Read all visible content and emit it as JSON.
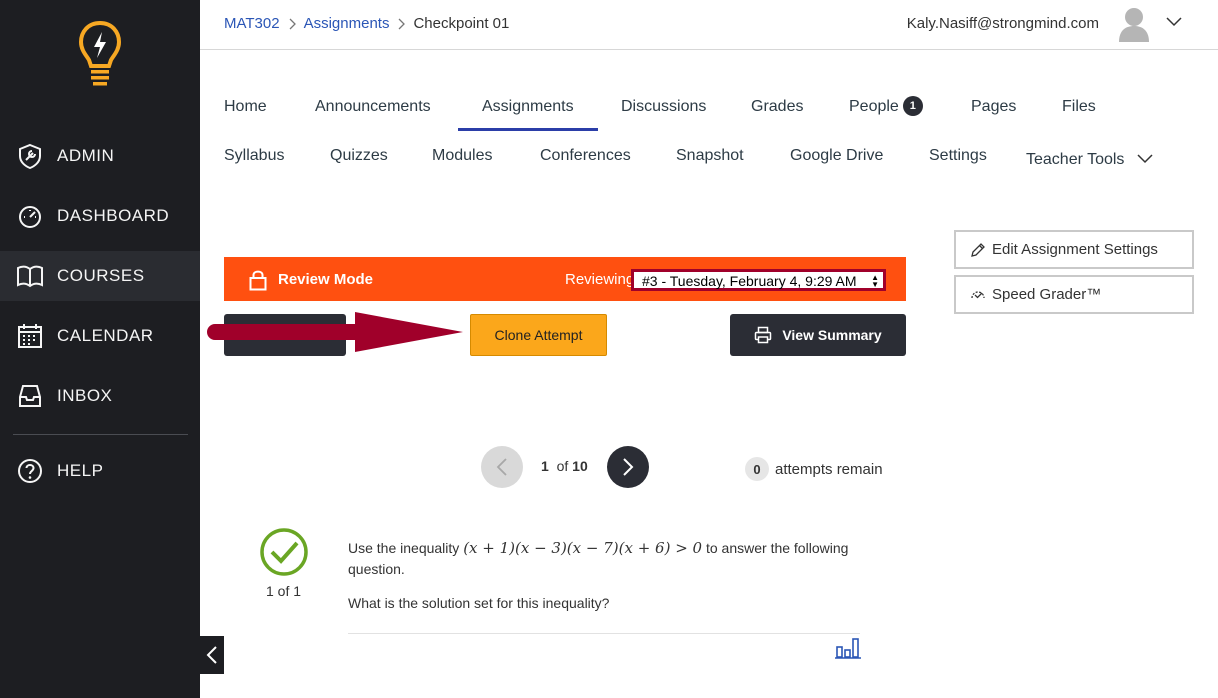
{
  "sidebar": {
    "items": [
      {
        "label": "ADMIN",
        "icon": "shield-wrench-icon"
      },
      {
        "label": "DASHBOARD",
        "icon": "speedometer-icon"
      },
      {
        "label": "COURSES",
        "icon": "book-icon"
      },
      {
        "label": "CALENDAR",
        "icon": "calendar-icon"
      },
      {
        "label": "INBOX",
        "icon": "inbox-icon"
      },
      {
        "label": "HELP",
        "icon": "help-circle-icon"
      }
    ],
    "active": "COURSES"
  },
  "breadcrumb": {
    "course": "MAT302",
    "section": "Assignments",
    "current": "Checkpoint 01"
  },
  "user": {
    "email": "Kaly.Nasiff@strongmind.com"
  },
  "tabs": {
    "row1": [
      "Home",
      "Announcements",
      "Assignments",
      "Discussions",
      "Grades",
      "People",
      "Pages",
      "Files"
    ],
    "row2": [
      "Syllabus",
      "Quizzes",
      "Modules",
      "Conferences",
      "Snapshot",
      "Google Drive",
      "Settings",
      "Teacher Tools"
    ],
    "active": "Assignments",
    "people_badge": "1"
  },
  "side_buttons": {
    "edit": "Edit Assignment Settings",
    "speed_grader": "Speed Grader™"
  },
  "review": {
    "mode_label": "Review Mode",
    "reviewing_label": "Reviewing",
    "selected_attempt": "#3 - Tuesday, February 4, 9:29 AM"
  },
  "actions": {
    "clone": "Clone Attempt",
    "view_summary": "View Summary"
  },
  "pagination": {
    "current": "1",
    "of": "of",
    "total": "10"
  },
  "attempts": {
    "count": "0",
    "label": "attempts remain"
  },
  "question": {
    "score": "1 of 1",
    "text_before": "Use the inequality",
    "math": "(x + 1)(x − 3)(x − 7)(x + 6) > 0",
    "text_after": "to answer the following question.",
    "sub": "What is the solution set for this inequality?"
  },
  "colors": {
    "sidebar_bg": "#1d1e22",
    "review_bar": "#ff5010",
    "clone_button": "#fba71b",
    "dark_button": "#2b2d35",
    "link": "#2b56b6",
    "success": "#6aa624",
    "annotation_arrow": "#a0002a"
  }
}
